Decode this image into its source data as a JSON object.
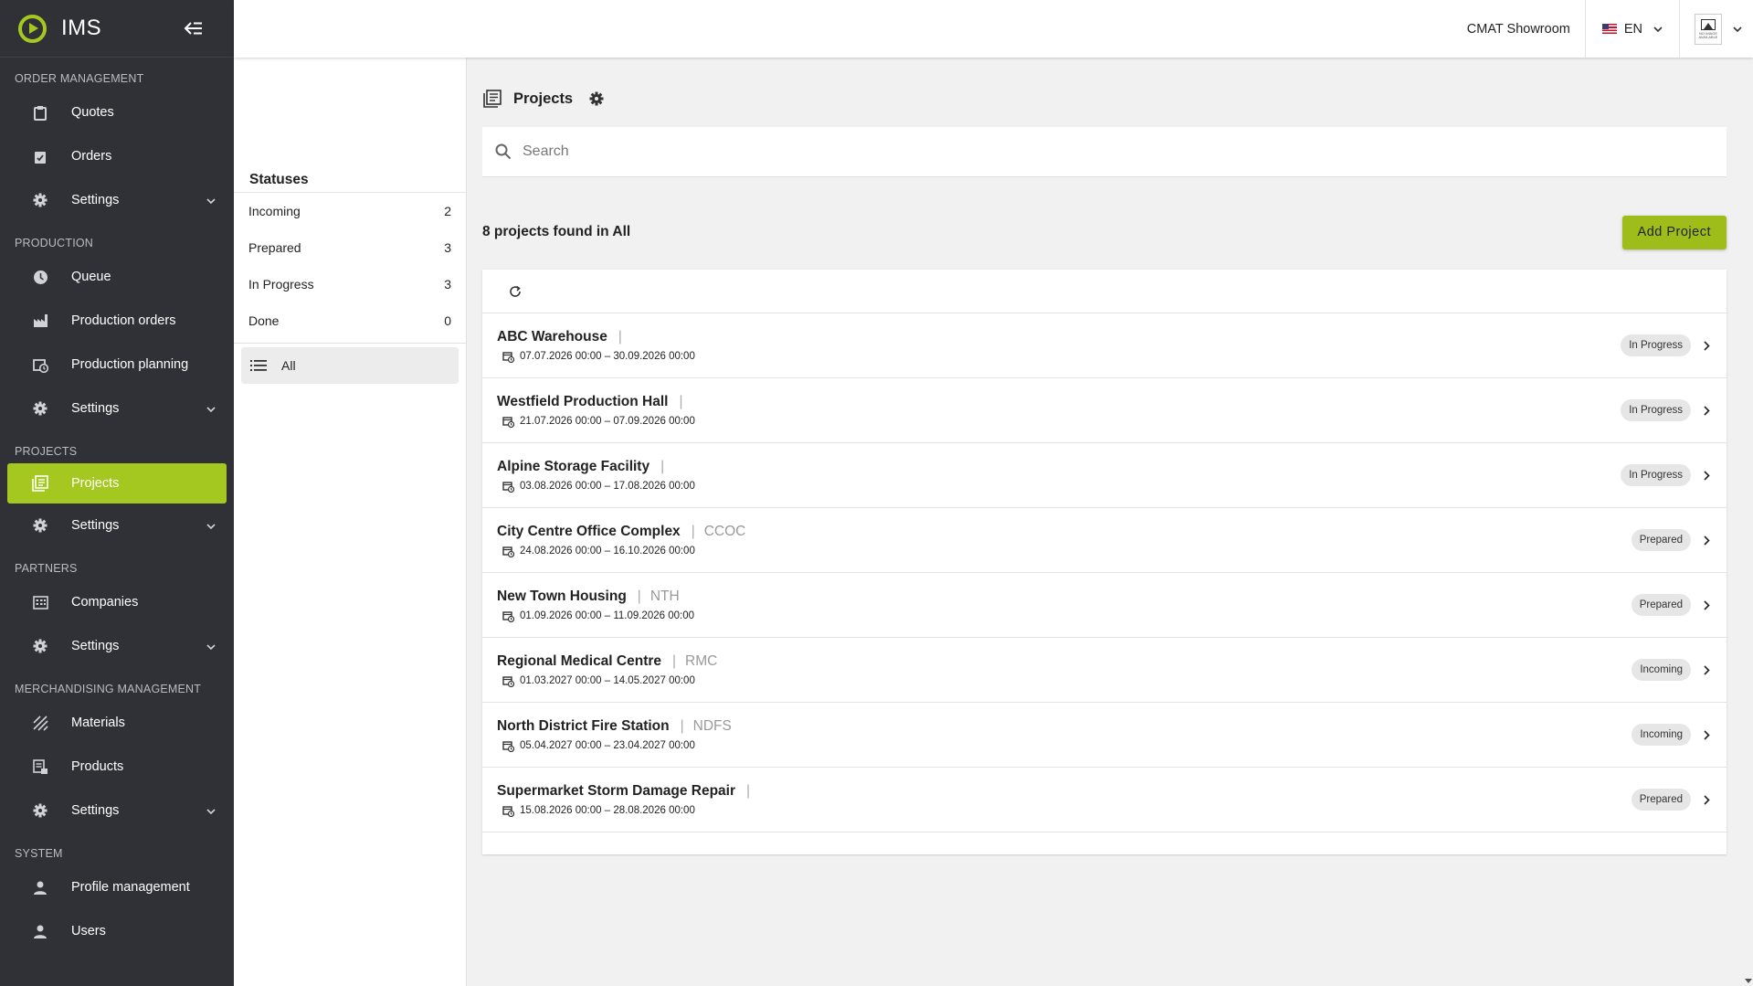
{
  "brand": {
    "name": "IMS",
    "accent": "#a5c820"
  },
  "sidebar": {
    "sections": [
      {
        "title": "ORDER MANAGEMENT",
        "items": [
          {
            "label": "Quotes",
            "icon": "clipboard-icon",
            "active": false,
            "has_chevron": false
          },
          {
            "label": "Orders",
            "icon": "clipboard-check-icon",
            "active": false,
            "has_chevron": false
          },
          {
            "label": "Settings",
            "icon": "gear-icon",
            "active": false,
            "has_chevron": true
          }
        ]
      },
      {
        "title": "PRODUCTION",
        "items": [
          {
            "label": "Queue",
            "icon": "clock-icon",
            "active": false,
            "has_chevron": false
          },
          {
            "label": "Production orders",
            "icon": "factory-icon",
            "active": false,
            "has_chevron": false
          },
          {
            "label": "Production planning",
            "icon": "calendar-clock-icon",
            "active": false,
            "has_chevron": false
          },
          {
            "label": "Settings",
            "icon": "gear-icon",
            "active": false,
            "has_chevron": true
          }
        ]
      },
      {
        "title": "PROJECTS",
        "items": [
          {
            "label": "Projects",
            "icon": "projects-icon",
            "active": true,
            "has_chevron": false
          },
          {
            "label": "Settings",
            "icon": "gear-icon",
            "active": false,
            "has_chevron": true
          }
        ]
      },
      {
        "title": "PARTNERS",
        "items": [
          {
            "label": "Companies",
            "icon": "building-icon",
            "active": false,
            "has_chevron": false
          },
          {
            "label": "Settings",
            "icon": "gear-icon",
            "active": false,
            "has_chevron": true
          }
        ]
      },
      {
        "title": "MERCHANDISING MANAGEMENT",
        "items": [
          {
            "label": "Materials",
            "icon": "texture-icon",
            "active": false,
            "has_chevron": false
          },
          {
            "label": "Products",
            "icon": "product-list-icon",
            "active": false,
            "has_chevron": false
          },
          {
            "label": "Settings",
            "icon": "gear-icon",
            "active": false,
            "has_chevron": true
          }
        ]
      },
      {
        "title": "SYSTEM",
        "items": [
          {
            "label": "Profile management",
            "icon": "person-icon",
            "active": false,
            "has_chevron": false
          },
          {
            "label": "Users",
            "icon": "person-icon",
            "active": false,
            "has_chevron": false
          }
        ]
      }
    ]
  },
  "topbar": {
    "company": "CMAT Showroom",
    "language": "EN",
    "avatar_text": "NO IMAGE AVAILABLE"
  },
  "statuses": {
    "title": "Statuses",
    "items": [
      {
        "label": "Incoming",
        "count": "2"
      },
      {
        "label": "Prepared",
        "count": "3"
      },
      {
        "label": "In Progress",
        "count": "3"
      },
      {
        "label": "Done",
        "count": "0"
      }
    ],
    "all_label": "All"
  },
  "main": {
    "title": "Projects",
    "search_placeholder": "Search",
    "found_text": "8 projects found in All",
    "add_button": "Add Project"
  },
  "projects": [
    {
      "name": "ABC Warehouse",
      "code": "",
      "dates": "07.07.2026 00:00 – 30.09.2026 00:00",
      "status": "In Progress"
    },
    {
      "name": "Westfield Production Hall",
      "code": "",
      "dates": "21.07.2026 00:00 – 07.09.2026 00:00",
      "status": "In Progress"
    },
    {
      "name": "Alpine Storage Facility",
      "code": "",
      "dates": "03.08.2026 00:00 – 17.08.2026 00:00",
      "status": "In Progress"
    },
    {
      "name": "City Centre Office Complex",
      "code": "CCOC",
      "dates": "24.08.2026 00:00 – 16.10.2026 00:00",
      "status": "Prepared"
    },
    {
      "name": "New Town Housing",
      "code": "NTH",
      "dates": "01.09.2026 00:00 – 11.09.2026 00:00",
      "status": "Prepared"
    },
    {
      "name": "Regional Medical Centre",
      "code": "RMC",
      "dates": "01.03.2027 00:00 – 14.05.2027 00:00",
      "status": "Incoming"
    },
    {
      "name": "North District Fire Station",
      "code": "NDFS",
      "dates": "05.04.2027 00:00 – 23.04.2027 00:00",
      "status": "Incoming"
    },
    {
      "name": "Supermarket Storm Damage Repair",
      "code": "",
      "dates": "15.08.2026 00:00 – 28.08.2026 00:00",
      "status": "Prepared"
    }
  ]
}
